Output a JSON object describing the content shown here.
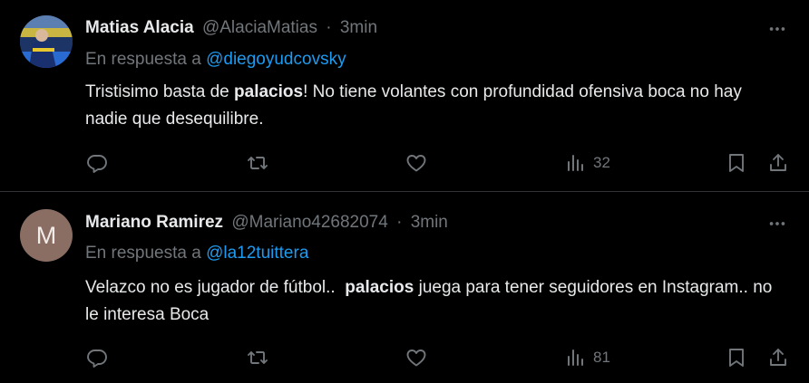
{
  "tweets": [
    {
      "display_name": "Matias Alacia",
      "handle": "@AlaciaMatias",
      "separator": "·",
      "time": "3min",
      "reply_prefix": "En respuesta a",
      "reply_to": "@diegoyudcovsky",
      "text_before": "Tristisimo basta de ",
      "text_bold": "palacios",
      "text_after": "! No tiene volantes con profundidad ofensiva boca no hay nadie que desequilibre.",
      "views": "32",
      "avatar": "photo"
    },
    {
      "display_name": "Mariano Ramirez",
      "handle": "@Mariano42682074",
      "separator": "·",
      "time": "3min",
      "reply_prefix": "En respuesta a",
      "reply_to": "@la12tuittera",
      "text_before": "Velazco no es jugador de fútbol..  ",
      "text_bold": "palacios",
      "text_after": " juega para tener seguidores en Instagram.. no le interesa Boca",
      "views": "81",
      "avatar_letter": "M"
    }
  ],
  "colors": {
    "background": "#000000",
    "text": "#e7e9ea",
    "secondary": "#71767b",
    "link": "#1d9bf0",
    "divider": "#2f3336",
    "avatar_letter_bg": "#8a6e64"
  },
  "icons": [
    "reply-icon",
    "retweet-icon",
    "like-icon",
    "views-icon",
    "bookmark-icon",
    "share-icon",
    "more-icon"
  ]
}
